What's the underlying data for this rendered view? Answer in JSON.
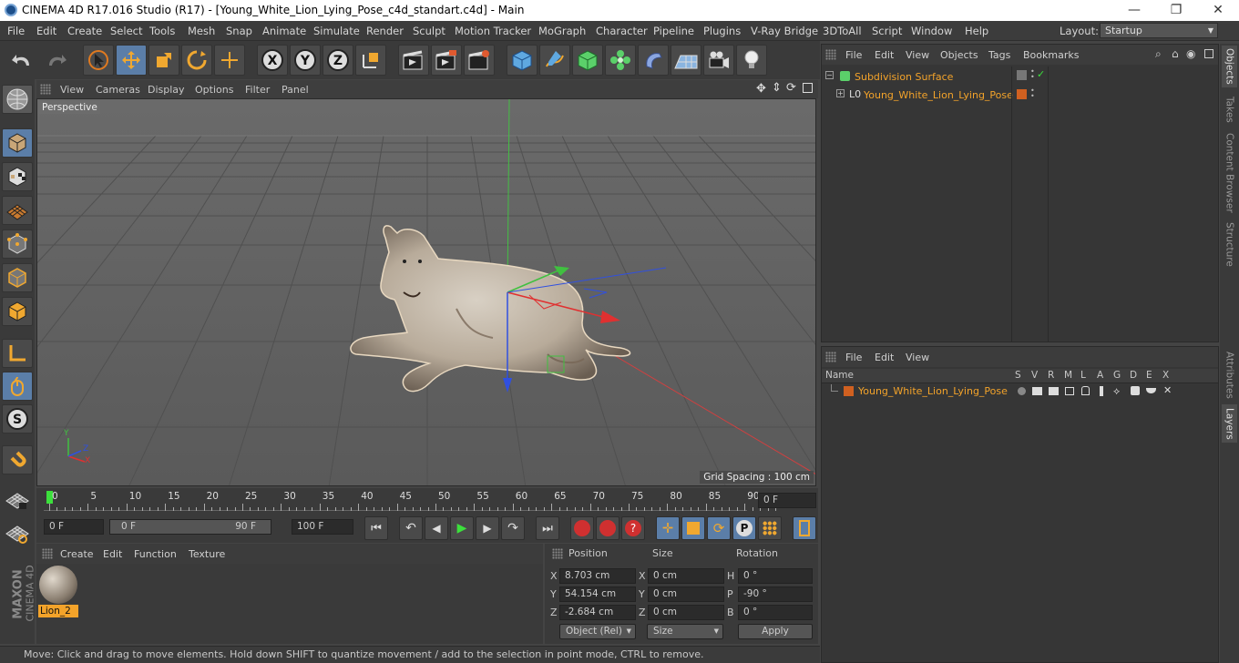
{
  "window": {
    "title": "CINEMA 4D R17.016 Studio (R17) - [Young_White_Lion_Lying_Pose_c4d_standart.c4d] - Main",
    "minimize": "—",
    "maximize": "❐",
    "close": "✕"
  },
  "menu": [
    "File",
    "Edit",
    "Create",
    "Select",
    "Tools",
    "Mesh",
    "Snap",
    "Animate",
    "Simulate",
    "Render",
    "Sculpt",
    "Motion Tracker",
    "MoGraph",
    "Character",
    "Pipeline",
    "Plugins",
    "V-Ray Bridge",
    "3DToAll",
    "Script",
    "Window",
    "Help"
  ],
  "layout": {
    "label": "Layout:",
    "value": "Startup"
  },
  "viewport": {
    "menu": [
      "View",
      "Cameras",
      "Display",
      "Options",
      "Filter",
      "Panel"
    ],
    "name": "Perspective",
    "grid_spacing": "Grid Spacing : 100 cm",
    "axis_labels": {
      "x": "X",
      "y": "Y",
      "z": "Z"
    }
  },
  "timeline": {
    "ticks": [
      "0",
      "5",
      "10",
      "15",
      "20",
      "25",
      "30",
      "35",
      "40",
      "45",
      "50",
      "55",
      "60",
      "65",
      "70",
      "75",
      "80",
      "85",
      "90"
    ],
    "current_frame": "0 F"
  },
  "playback": {
    "start": "0 F",
    "range_start": "0 F",
    "range_end": "90 F",
    "end": "100 F"
  },
  "material_panel": {
    "menu": [
      "Create",
      "Edit",
      "Function",
      "Texture"
    ],
    "material_name": "Lion_2"
  },
  "attributes": {
    "headers": {
      "position": "Position",
      "size": "Size",
      "rotation": "Rotation"
    },
    "rows": [
      {
        "axis": "X",
        "pos": "8.703 cm",
        "size_axis": "X",
        "size": "0 cm",
        "rot_axis": "H",
        "rot": "0 °"
      },
      {
        "axis": "Y",
        "pos": "54.154 cm",
        "size_axis": "Y",
        "size": "0 cm",
        "rot_axis": "P",
        "rot": "-90 °"
      },
      {
        "axis": "Z",
        "pos": "-2.684 cm",
        "size_axis": "Z",
        "size": "0 cm",
        "rot_axis": "B",
        "rot": "0 °"
      }
    ],
    "mode": "Object (Rel)",
    "size_mode": "Size",
    "apply": "Apply"
  },
  "status": "Move: Click and drag to move elements. Hold down SHIFT to quantize movement / add to the selection in point mode, CTRL to remove.",
  "objects_panel": {
    "menu": [
      "File",
      "Edit",
      "View",
      "Objects",
      "Tags",
      "Bookmarks"
    ],
    "items": [
      {
        "name": "Subdivision Surface"
      },
      {
        "name": "Young_White_Lion_Lying_Pose"
      }
    ]
  },
  "layers_panel": {
    "menu": [
      "File",
      "Edit",
      "View"
    ],
    "columns": [
      "Name",
      "S",
      "V",
      "R",
      "M",
      "L",
      "A",
      "G",
      "D",
      "E",
      "X"
    ],
    "layer_name": "Young_White_Lion_Lying_Pose"
  },
  "side_tabs": [
    "Objects",
    "Takes",
    "Content Browser",
    "Structure",
    "Attributes",
    "Layers"
  ],
  "brand": {
    "maxon": "MAXON",
    "product": "CINEMA 4D"
  }
}
